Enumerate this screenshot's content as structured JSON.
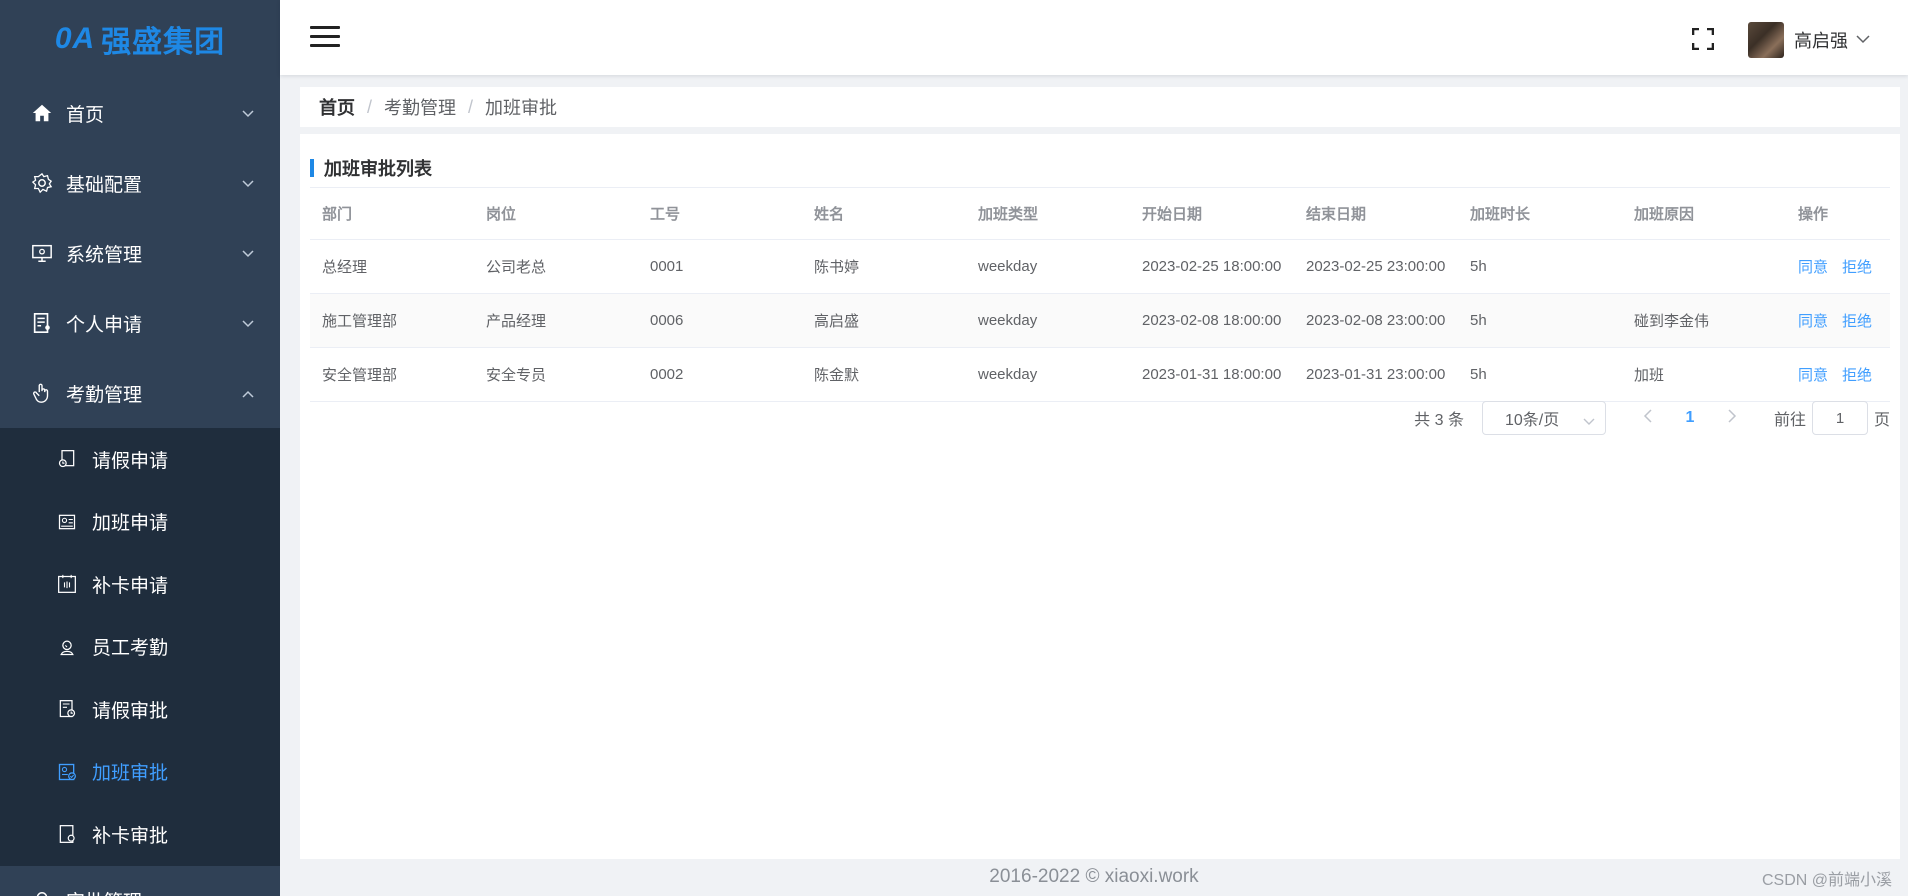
{
  "colors": {
    "sidebar_bg": "#304156",
    "accent": "#409eff",
    "logo": "#1e88e5"
  },
  "logo": {
    "oa": "0A",
    "name": "强盛集团"
  },
  "sidebar": {
    "items": [
      {
        "label": "首页",
        "icon": "home-icon"
      },
      {
        "label": "基础配置",
        "icon": "gear-icon"
      },
      {
        "label": "系统管理",
        "icon": "monitor-icon"
      },
      {
        "label": "个人申请",
        "icon": "document-user-icon"
      },
      {
        "label": "考勤管理",
        "icon": "hand-icon"
      }
    ],
    "subitems": [
      {
        "label": "请假申请",
        "icon": "leave-request-icon"
      },
      {
        "label": "加班申请",
        "icon": "overtime-request-icon"
      },
      {
        "label": "补卡申请",
        "icon": "card-request-icon"
      },
      {
        "label": "员工考勤",
        "icon": "employee-attendance-icon"
      },
      {
        "label": "请假审批",
        "icon": "leave-approval-icon"
      },
      {
        "label": "加班审批",
        "icon": "overtime-approval-icon"
      },
      {
        "label": "补卡审批",
        "icon": "card-approval-icon"
      }
    ],
    "next_label": "审批管理"
  },
  "header": {
    "user_name": "高启强"
  },
  "breadcrumb": {
    "home": "首页",
    "level1": "考勤管理",
    "level2": "加班审批"
  },
  "panel": {
    "title": "加班审批列表"
  },
  "table": {
    "headers": [
      "部门",
      "岗位",
      "工号",
      "姓名",
      "加班类型",
      "开始日期",
      "结束日期",
      "加班时长",
      "加班原因",
      "操作"
    ],
    "rows": [
      [
        "总经理",
        "公司老总",
        "0001",
        "陈书婷",
        "weekday",
        "2023-02-25 18:00:00",
        "2023-02-25 23:00:00",
        "5h",
        ""
      ],
      [
        "施工管理部",
        "产品经理",
        "0006",
        "高启盛",
        "weekday",
        "2023-02-08 18:00:00",
        "2023-02-08 23:00:00",
        "5h",
        "碰到李金伟"
      ],
      [
        "安全管理部",
        "安全专员",
        "0002",
        "陈金默",
        "weekday",
        "2023-01-31 18:00:00",
        "2023-01-31 23:00:00",
        "5h",
        "加班"
      ]
    ],
    "agree_label": "同意",
    "reject_label": "拒绝"
  },
  "pagination": {
    "total": "共 3 条",
    "page_size": "10条/页",
    "current_page": "1",
    "goto_prefix": "前往",
    "goto_value": "1",
    "goto_suffix": "页"
  },
  "footer": {
    "copyright": "2016-2022 © xiaoxi.work",
    "watermark": "CSDN @前端小溪"
  }
}
